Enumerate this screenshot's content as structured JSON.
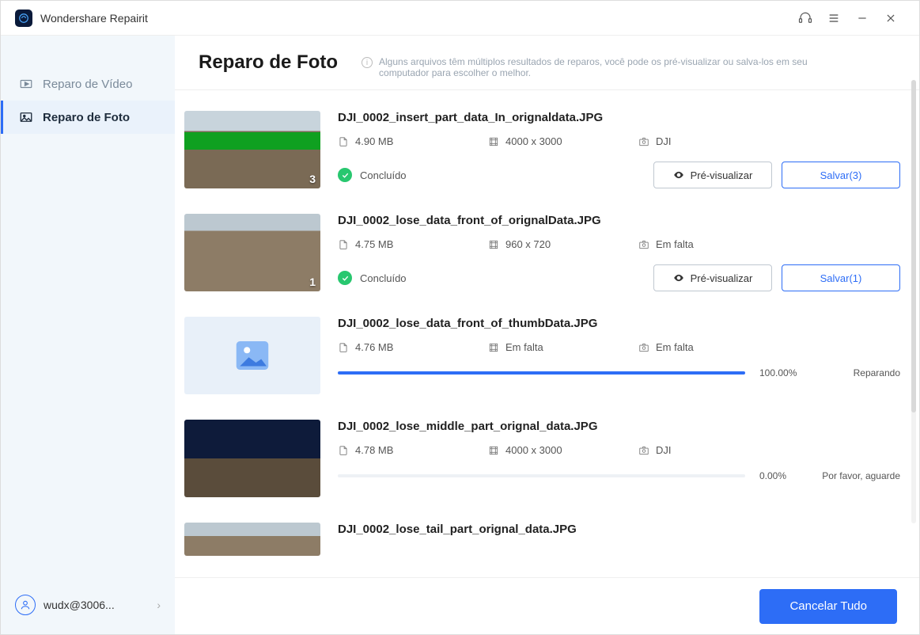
{
  "app": {
    "title": "Wondershare Repairit"
  },
  "sidebar": {
    "items": [
      {
        "label": "Reparo de Vídeo"
      },
      {
        "label": "Reparo de Foto"
      }
    ],
    "user": "wudx@3006..."
  },
  "header": {
    "title": "Reparo de Foto",
    "subtitle": "Alguns arquivos têm múltiplos resultados de reparos, você pode os pré-visualizar ou salva-los em seu computador para escolher o melhor."
  },
  "labels": {
    "preview": "Pré-visualizar",
    "completed": "Concluído"
  },
  "files": [
    {
      "name": "DJI_0002_insert_part_data_In_orignaldata.JPG",
      "size": "4.90  MB",
      "dimensions": "4000 x 3000",
      "camera": "DJI",
      "status": "done",
      "badge": "3",
      "save_label": "Salvar(3)"
    },
    {
      "name": "DJI_0002_lose_data_front_of_orignalData.JPG",
      "size": "4.75  MB",
      "dimensions": "960 x 720",
      "camera": "Em falta",
      "status": "done",
      "badge": "1",
      "save_label": "Salvar(1)"
    },
    {
      "name": "DJI_0002_lose_data_front_of_thumbData.JPG",
      "size": "4.76  MB",
      "dimensions": "Em falta",
      "camera": "Em falta",
      "status": "repairing",
      "percent": "100.00%",
      "progress_label": "Reparando",
      "progress_fill": "100%"
    },
    {
      "name": "DJI_0002_lose_middle_part_orignal_data.JPG",
      "size": "4.78  MB",
      "dimensions": "4000 x 3000",
      "camera": "DJI",
      "status": "waiting",
      "percent": "0.00%",
      "progress_label": "Por favor, aguarde",
      "progress_fill": "0%"
    },
    {
      "name": "DJI_0002_lose_tail_part_orignal_data.JPG"
    }
  ],
  "footer": {
    "cancel": "Cancelar Tudo"
  }
}
